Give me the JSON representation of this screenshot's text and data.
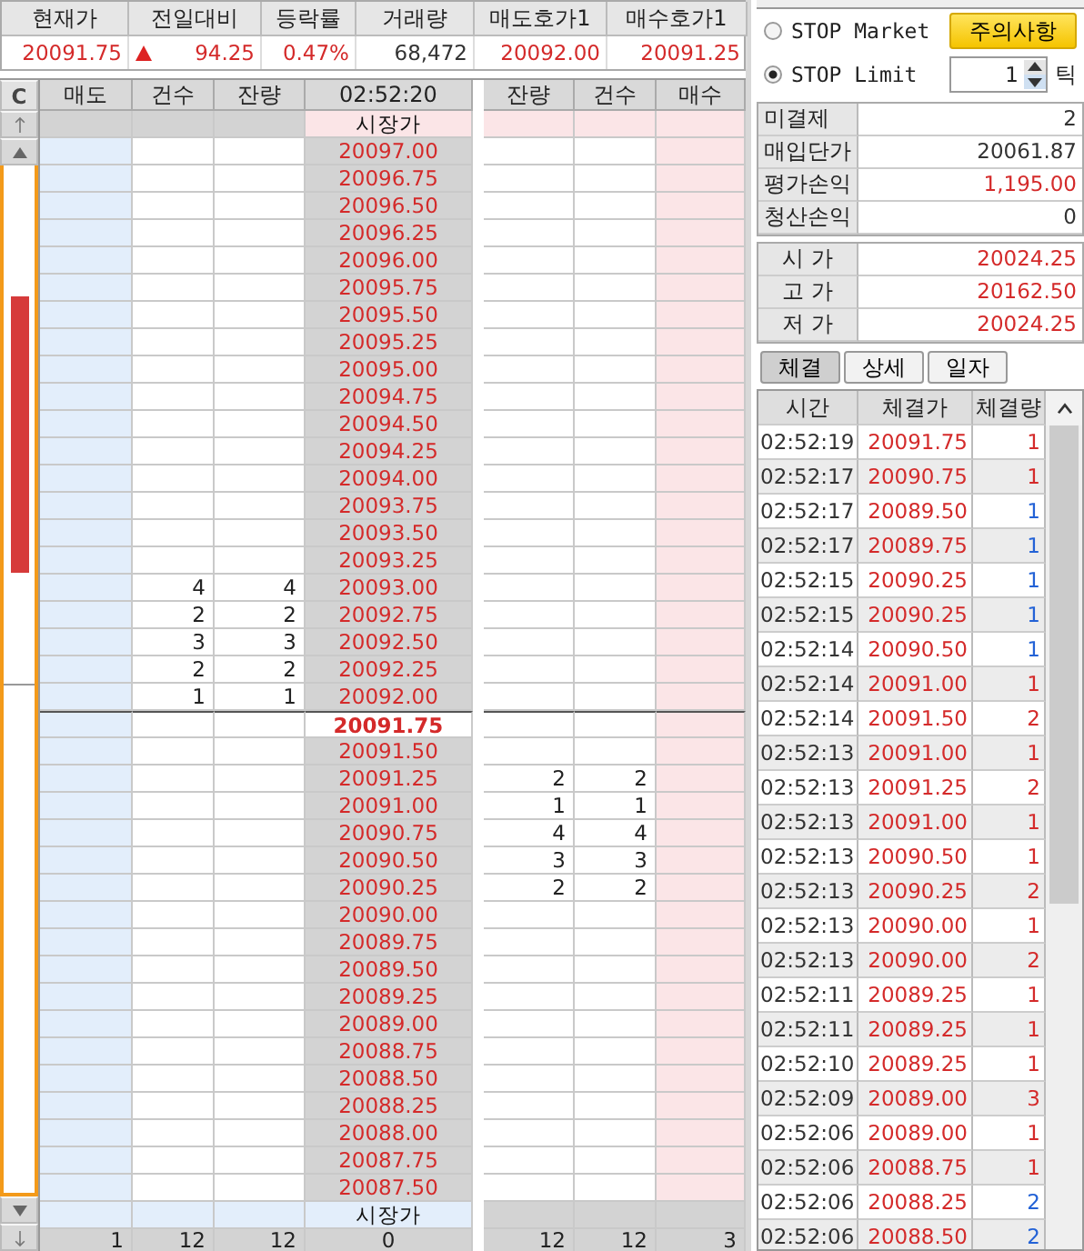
{
  "quote": {
    "columns": [
      {
        "label": "현재가",
        "value": "20091.75",
        "color": "#d42a2a"
      },
      {
        "label": "전일대비",
        "value": "94.25",
        "color": "#d42a2a",
        "rising": true
      },
      {
        "label": "등락률",
        "value": "0.47%",
        "color": "#d42a2a"
      },
      {
        "label": "거래량",
        "value": "68,472",
        "color": "#333333"
      },
      {
        "label": "매도호가1",
        "value": "20092.00",
        "color": "#d42a2a"
      },
      {
        "label": "매수호가1",
        "value": "20091.25",
        "color": "#d42a2a"
      }
    ]
  },
  "ladder": {
    "corner": "C",
    "columns": [
      "매도",
      "건수",
      "잔량",
      "02:52:20",
      "잔량",
      "건수",
      "매수"
    ],
    "rows": [
      {
        "kind": "market_top",
        "price": "시장가"
      },
      {
        "kind": "level",
        "price": "20097.00"
      },
      {
        "kind": "level",
        "price": "20096.75"
      },
      {
        "kind": "level",
        "price": "20096.50"
      },
      {
        "kind": "level",
        "price": "20096.25"
      },
      {
        "kind": "level",
        "price": "20096.00"
      },
      {
        "kind": "level",
        "price": "20095.75"
      },
      {
        "kind": "level",
        "price": "20095.50"
      },
      {
        "kind": "level",
        "price": "20095.25"
      },
      {
        "kind": "level",
        "price": "20095.00"
      },
      {
        "kind": "level",
        "price": "20094.75"
      },
      {
        "kind": "level",
        "price": "20094.50"
      },
      {
        "kind": "level",
        "price": "20094.25"
      },
      {
        "kind": "level",
        "price": "20094.00"
      },
      {
        "kind": "level",
        "price": "20093.75"
      },
      {
        "kind": "level",
        "price": "20093.50"
      },
      {
        "kind": "level",
        "price": "20093.25"
      },
      {
        "kind": "level",
        "price": "20093.00",
        "sell_count": "4",
        "sell_qty": "4"
      },
      {
        "kind": "level",
        "price": "20092.75",
        "sell_count": "2",
        "sell_qty": "2"
      },
      {
        "kind": "level",
        "price": "20092.50",
        "sell_count": "3",
        "sell_qty": "3"
      },
      {
        "kind": "level",
        "price": "20092.25",
        "sell_count": "2",
        "sell_qty": "2"
      },
      {
        "kind": "level",
        "price": "20092.00",
        "sell_count": "1",
        "sell_qty": "1"
      },
      {
        "kind": "current",
        "price": "20091.75"
      },
      {
        "kind": "level",
        "price": "20091.50"
      },
      {
        "kind": "level",
        "price": "20091.25",
        "buy_qty": "2",
        "buy_count": "2"
      },
      {
        "kind": "level",
        "price": "20091.00",
        "buy_qty": "1",
        "buy_count": "1"
      },
      {
        "kind": "level",
        "price": "20090.75",
        "buy_qty": "4",
        "buy_count": "4"
      },
      {
        "kind": "level",
        "price": "20090.50",
        "buy_qty": "3",
        "buy_count": "3"
      },
      {
        "kind": "level",
        "price": "20090.25",
        "buy_qty": "2",
        "buy_count": "2"
      },
      {
        "kind": "level",
        "price": "20090.00"
      },
      {
        "kind": "level",
        "price": "20089.75"
      },
      {
        "kind": "level",
        "price": "20089.50"
      },
      {
        "kind": "level",
        "price": "20089.25"
      },
      {
        "kind": "level",
        "price": "20089.00"
      },
      {
        "kind": "level",
        "price": "20088.75"
      },
      {
        "kind": "level",
        "price": "20088.50"
      },
      {
        "kind": "level",
        "price": "20088.25"
      },
      {
        "kind": "level",
        "price": "20088.00"
      },
      {
        "kind": "level",
        "price": "20087.75"
      },
      {
        "kind": "level",
        "price": "20087.50"
      },
      {
        "kind": "market_bottom",
        "price": "시장가"
      }
    ],
    "totals": [
      "1",
      "12",
      "12",
      "0",
      "12",
      "12",
      "3"
    ]
  },
  "stop": {
    "options": [
      {
        "label": "STOP Market",
        "selected": false
      },
      {
        "label": "STOP Limit",
        "selected": true
      }
    ],
    "warning_button": "주의사항",
    "ticks": "1",
    "tick_unit": "틱"
  },
  "position": [
    {
      "label": "미결제",
      "value": "2",
      "color": "#333333"
    },
    {
      "label": "매입단가",
      "value": "20061.87",
      "color": "#333333"
    },
    {
      "label": "평가손익",
      "value": "1,195.00",
      "color": "#d42a2a"
    },
    {
      "label": "청산손익",
      "value": "0",
      "color": "#333333"
    }
  ],
  "ohl": [
    {
      "label": "시 가",
      "value": "20024.25"
    },
    {
      "label": "고 가",
      "value": "20162.50"
    },
    {
      "label": "저 가",
      "value": "20024.25"
    }
  ],
  "tabs": [
    {
      "label": "체결",
      "selected": true
    },
    {
      "label": "상세",
      "selected": false
    },
    {
      "label": "일자",
      "selected": false
    }
  ],
  "trades": {
    "columns": [
      "시간",
      "체결가",
      "체결량"
    ],
    "rows": [
      {
        "time": "02:52:19",
        "price": "20091.75",
        "qty": "1",
        "color": "#d42a2a"
      },
      {
        "time": "02:52:17",
        "price": "20090.75",
        "qty": "1",
        "color": "#d42a2a"
      },
      {
        "time": "02:52:17",
        "price": "20089.50",
        "qty": "1",
        "color": "#2362d6"
      },
      {
        "time": "02:52:17",
        "price": "20089.75",
        "qty": "1",
        "color": "#2362d6"
      },
      {
        "time": "02:52:15",
        "price": "20090.25",
        "qty": "1",
        "color": "#2362d6"
      },
      {
        "time": "02:52:15",
        "price": "20090.25",
        "qty": "1",
        "color": "#2362d6"
      },
      {
        "time": "02:52:14",
        "price": "20090.50",
        "qty": "1",
        "color": "#2362d6"
      },
      {
        "time": "02:52:14",
        "price": "20091.00",
        "qty": "1",
        "color": "#d42a2a"
      },
      {
        "time": "02:52:14",
        "price": "20091.50",
        "qty": "2",
        "color": "#d42a2a"
      },
      {
        "time": "02:52:13",
        "price": "20091.00",
        "qty": "1",
        "color": "#d42a2a"
      },
      {
        "time": "02:52:13",
        "price": "20091.25",
        "qty": "2",
        "color": "#d42a2a"
      },
      {
        "time": "02:52:13",
        "price": "20091.00",
        "qty": "1",
        "color": "#d42a2a"
      },
      {
        "time": "02:52:13",
        "price": "20090.50",
        "qty": "1",
        "color": "#d42a2a"
      },
      {
        "time": "02:52:13",
        "price": "20090.25",
        "qty": "2",
        "color": "#d42a2a"
      },
      {
        "time": "02:52:13",
        "price": "20090.00",
        "qty": "1",
        "color": "#d42a2a"
      },
      {
        "time": "02:52:13",
        "price": "20090.00",
        "qty": "2",
        "color": "#d42a2a"
      },
      {
        "time": "02:52:11",
        "price": "20089.25",
        "qty": "1",
        "color": "#d42a2a"
      },
      {
        "time": "02:52:11",
        "price": "20089.25",
        "qty": "1",
        "color": "#d42a2a"
      },
      {
        "time": "02:52:10",
        "price": "20089.25",
        "qty": "1",
        "color": "#d42a2a"
      },
      {
        "time": "02:52:09",
        "price": "20089.00",
        "qty": "3",
        "color": "#d42a2a"
      },
      {
        "time": "02:52:06",
        "price": "20089.00",
        "qty": "1",
        "color": "#d42a2a"
      },
      {
        "time": "02:52:06",
        "price": "20088.75",
        "qty": "1",
        "color": "#d42a2a"
      },
      {
        "time": "02:52:06",
        "price": "20088.25",
        "qty": "2",
        "color": "#2362d6"
      },
      {
        "time": "02:52:06",
        "price": "20088.50",
        "qty": "2",
        "color": "#2362d6"
      }
    ]
  }
}
